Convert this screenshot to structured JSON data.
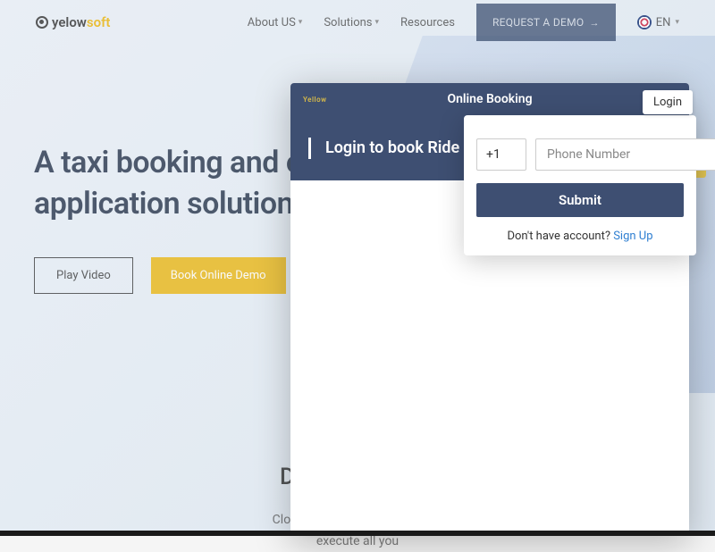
{
  "brand": {
    "a": "yelow",
    "b": "soft"
  },
  "nav": {
    "about": "About US",
    "solutions": "Solutions",
    "resources": "Resources",
    "demo": "REQUEST A DEMO",
    "lang": "EN"
  },
  "hero": {
    "title_l1": "A taxi booking and o",
    "title_l2": "application solution",
    "play": "Play Video",
    "book": "Book Online Demo"
  },
  "section2": {
    "heading": "Dispatch made",
    "body_l1": "Cloud technology is revolutioni",
    "body_l2": "execute all you"
  },
  "panel": {
    "logo": "Yellow",
    "title": "Online Booking",
    "subtitle": "Login to book Ride"
  },
  "login": {
    "tab": "Login",
    "code": "+1",
    "phone_placeholder": "Phone Number",
    "submit": "Submit",
    "noacct": "Don't have account? ",
    "signup": "Sign Up"
  }
}
